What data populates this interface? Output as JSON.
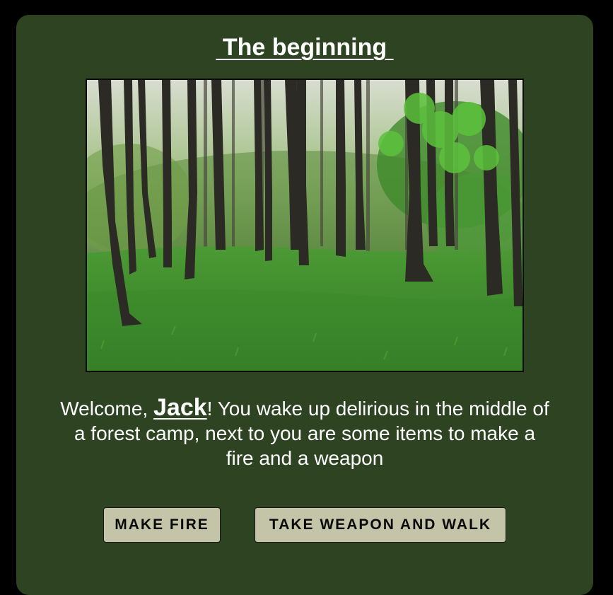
{
  "page": {
    "title": " The beginning "
  },
  "scene": {
    "image": "forest-clearing-scene",
    "colors": {
      "sky": "#d8ddd0",
      "canopy": "#5a8a3a",
      "grass": "#3f8a2e",
      "trunk": "#2c2a24"
    }
  },
  "story": {
    "greeting": "Welcome, ",
    "player_name": "Jack",
    "text_after_name": "! You wake up delirious in the middle of a forest camp, next to you are some items to make a fire and a weapon"
  },
  "choices": {
    "make_fire_label": "Make Fire",
    "take_weapon_label": "Take Weapon And Walk"
  },
  "colors": {
    "background": "#000000",
    "panel": "#2d4322",
    "button": "#c4c5a8",
    "text": "#ffffff"
  }
}
